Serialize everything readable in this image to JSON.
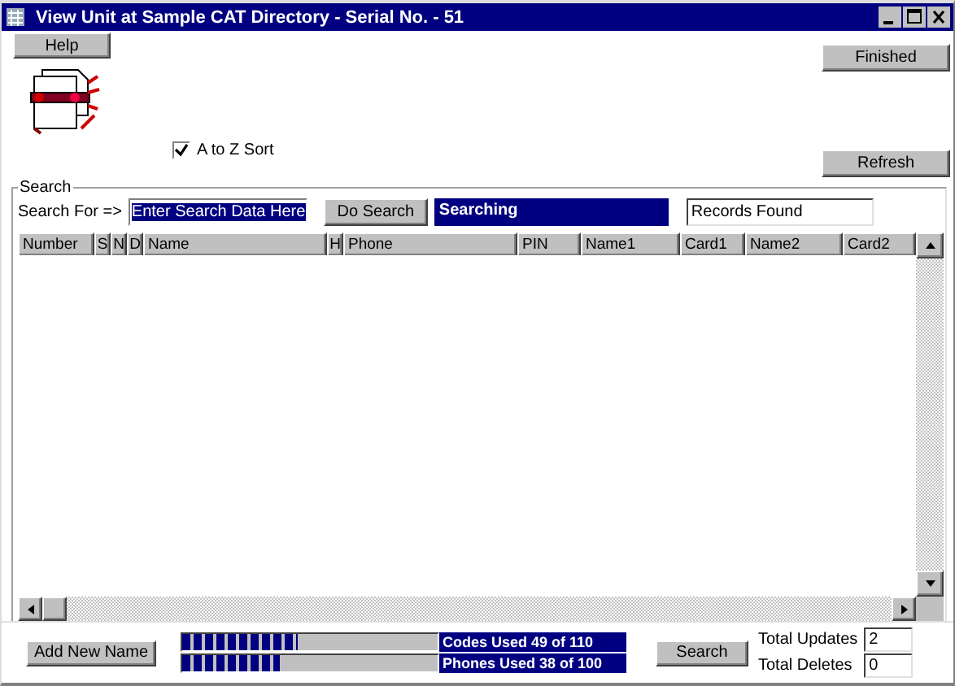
{
  "window": {
    "title": "View Unit at Sample CAT Directory - Serial No. - 51"
  },
  "toolbar": {
    "help": "Help",
    "finished": "Finished",
    "refresh": "Refresh"
  },
  "sort_checkbox": {
    "label": "A to Z  Sort",
    "checked": true
  },
  "search": {
    "group_label": "Search",
    "prompt": "Search For =>",
    "field_value": "Enter Search Data Here",
    "button": "Do Search",
    "status": "Searching",
    "records_found": "Records Found"
  },
  "table": {
    "columns": [
      "Number",
      "S",
      "N",
      "D",
      "Name",
      "H",
      "Phone",
      "PIN",
      "Name1",
      "Card1",
      "Name2",
      "Card2"
    ]
  },
  "footer": {
    "add_button": "Add New Name",
    "meters": [
      {
        "label": "Codes  Used 49 of 110",
        "level": 0.45
      },
      {
        "label": "Phones Used 38 of 100",
        "level": 0.38
      }
    ],
    "search_button": "Search",
    "totals": [
      {
        "label": "Total Updates",
        "value": "2"
      },
      {
        "label": "Total Deletes",
        "value": "0"
      }
    ]
  }
}
